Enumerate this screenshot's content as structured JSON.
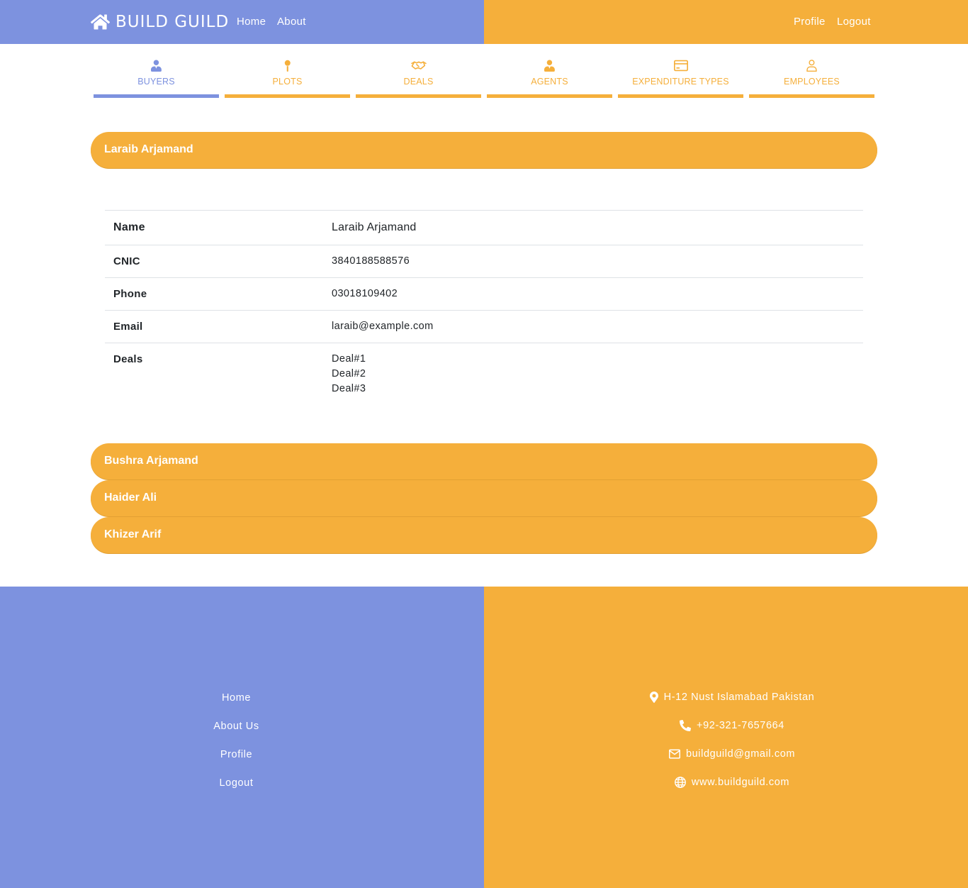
{
  "header": {
    "brand": "BUILD GUILD",
    "brand_icon": "home-icon",
    "nav_left": [
      "Home",
      "About"
    ],
    "nav_right": [
      "Profile",
      "Logout"
    ]
  },
  "colors": {
    "primary": "#7d92df",
    "accent": "#f5af3b",
    "link": "#2a7fe6"
  },
  "tabs": [
    {
      "label": "BUYERS",
      "icon": "buyer-icon",
      "active": true
    },
    {
      "label": "PLOTS",
      "icon": "map-pin-icon",
      "active": false
    },
    {
      "label": "DEALS",
      "icon": "handshake-icon",
      "active": false
    },
    {
      "label": "AGENTS",
      "icon": "agent-icon",
      "active": false
    },
    {
      "label": "EXPENDITURE TYPES",
      "icon": "credit-card-icon",
      "active": false
    },
    {
      "label": "EMPLOYEES",
      "icon": "user-outline-icon",
      "active": false
    }
  ],
  "buyers": [
    {
      "name": "Laraib Arjamand",
      "expanded": true
    },
    {
      "name": "Bushra Arjamand",
      "expanded": false
    },
    {
      "name": "Haider Ali",
      "expanded": false
    },
    {
      "name": "Khizer Arif",
      "expanded": false
    }
  ],
  "details": {
    "name_label": "Name",
    "name_value": "Laraib Arjamand",
    "cnic_label": "CNIC",
    "cnic_value": "3840188588576",
    "phone_label": "Phone",
    "phone_value": "03018109402",
    "email_label": "Email",
    "email_value": "laraib@example.com",
    "deals_label": "Deals",
    "deals": [
      "Deal#1",
      "Deal#2",
      "Deal#3"
    ]
  },
  "footer": {
    "links": [
      "Home",
      "About Us",
      "Profile",
      "Logout"
    ],
    "address": "H-12 Nust Islamabad Pakistan",
    "phone": "+92-321-7657664",
    "email": "buildguild@gmail.com",
    "website": "www.buildguild.com"
  }
}
